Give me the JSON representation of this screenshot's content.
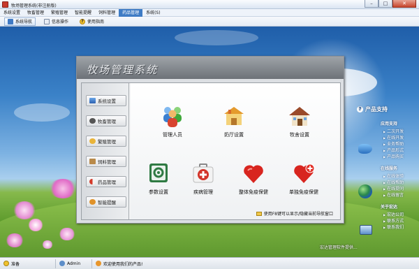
{
  "window": {
    "title": "牧场管理系统(非注册版)",
    "buttons": {
      "minimize": "–",
      "maximize": "□",
      "close": "✕"
    }
  },
  "menu": [
    {
      "label": "系统设置",
      "active": false
    },
    {
      "label": "牧畜管理",
      "active": false
    },
    {
      "label": "繁殖管理",
      "active": false
    },
    {
      "label": "智能提醒",
      "active": false
    },
    {
      "label": "饲料管理",
      "active": false
    },
    {
      "label": "药品管理",
      "active": true
    },
    {
      "label": "系统(S)",
      "active": false
    }
  ],
  "toolbar": [
    {
      "label": "系统导航",
      "icon": "nav-icon",
      "active": true
    },
    {
      "label": "信息操作",
      "icon": "info-icon",
      "active": false
    },
    {
      "label": "使用指南",
      "icon": "help-icon",
      "active": false
    }
  ],
  "panel": {
    "title": "牧场管理系统",
    "sidebar": [
      {
        "label": "系统设置",
        "icon": "monitor-icon"
      },
      {
        "label": "牧畜管理",
        "icon": "cow-icon"
      },
      {
        "label": "繁殖管理",
        "icon": "breeding-icon"
      },
      {
        "label": "饲料管理",
        "icon": "feed-icon"
      },
      {
        "label": "药品管理",
        "icon": "pills-icon"
      },
      {
        "label": "智能提醒",
        "icon": "alarm-icon"
      }
    ],
    "functions": [
      {
        "label": "管理人员",
        "icon": "users-icon"
      },
      {
        "label": "奶厅设置",
        "icon": "milk-hall-icon"
      },
      {
        "label": "牧舍设置",
        "icon": "barn-icon"
      },
      {
        "label": "参数设置",
        "icon": "settings-icon"
      },
      {
        "label": "疾病管理",
        "icon": "medical-kit-icon"
      },
      {
        "label": "整体免疫保健",
        "icon": "heart-icon"
      },
      {
        "label": "单独免疫保健",
        "icon": "heart-plus-icon"
      }
    ],
    "hint": "使用F8键可以显示/隐藏当前导航窗口"
  },
  "support": {
    "title": "产品支持",
    "sections": [
      {
        "title": "应用支持",
        "links": [
          "二次开发",
          "在线开发",
          "业务帮助",
          "产品形式",
          "产品购买"
        ]
      },
      {
        "title": "在线服务",
        "links": [
          "在线体验",
          "在线帮助",
          "在线提问",
          "在线留言"
        ]
      },
      {
        "title": "关于宏达",
        "links": [
          "宏达公司",
          "联系方式",
          "联系我们"
        ]
      }
    ],
    "footer": "宏达管理软件提供..."
  },
  "status": {
    "state": "准备",
    "user": "Admin",
    "message": "欢迎使用我们的产品!"
  }
}
